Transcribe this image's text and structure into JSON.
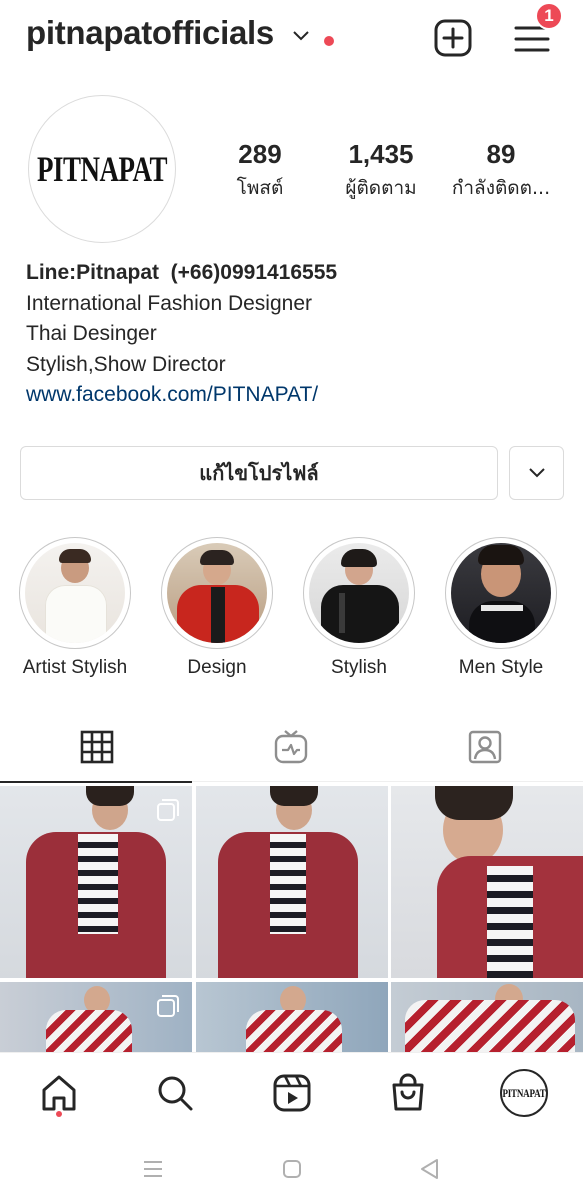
{
  "header": {
    "username": "pitnapatofficials",
    "notification_count": "1",
    "icons": {
      "switch_account": "chevron-down-icon",
      "new_post": "plus-square-icon",
      "menu": "hamburger-menu-icon"
    },
    "accent_color": "#ed4956"
  },
  "profile": {
    "avatar_text": "PITNAPAT",
    "stats": [
      {
        "value": "289",
        "label": "โพสต์"
      },
      {
        "value": "1,435",
        "label": "ผู้ติดตาม"
      },
      {
        "value": "89",
        "label": "กำลังติดต..."
      }
    ],
    "bio": {
      "name_line": "Line:Pitnapat  (+66)0991416555",
      "lines": [
        "International Fashion Designer",
        "Thai Desinger",
        "Stylish,Show Director"
      ],
      "link": "www.facebook.com/PITNAPAT/",
      "link_color": "#00376b"
    }
  },
  "actions": {
    "edit_profile_label": "แก้ไขโปรไฟล์",
    "more_icon": "chevron-down-icon"
  },
  "highlights": [
    {
      "label": "Artist Stylish"
    },
    {
      "label": "Design"
    },
    {
      "label": "Stylish"
    },
    {
      "label": "Men Style"
    }
  ],
  "tabs": [
    {
      "icon": "grid-icon",
      "active": true
    },
    {
      "icon": "igtv-icon",
      "active": false
    },
    {
      "icon": "tagged-icon",
      "active": false
    }
  ],
  "bottom_nav": [
    {
      "icon": "home-icon",
      "active": true
    },
    {
      "icon": "search-icon"
    },
    {
      "icon": "reels-icon"
    },
    {
      "icon": "shop-icon"
    },
    {
      "icon": "profile-avatar",
      "text": "PITNAPAT"
    }
  ],
  "system_nav": [
    {
      "icon": "recent-apps-icon"
    },
    {
      "icon": "home-square-icon"
    },
    {
      "icon": "back-icon"
    }
  ]
}
